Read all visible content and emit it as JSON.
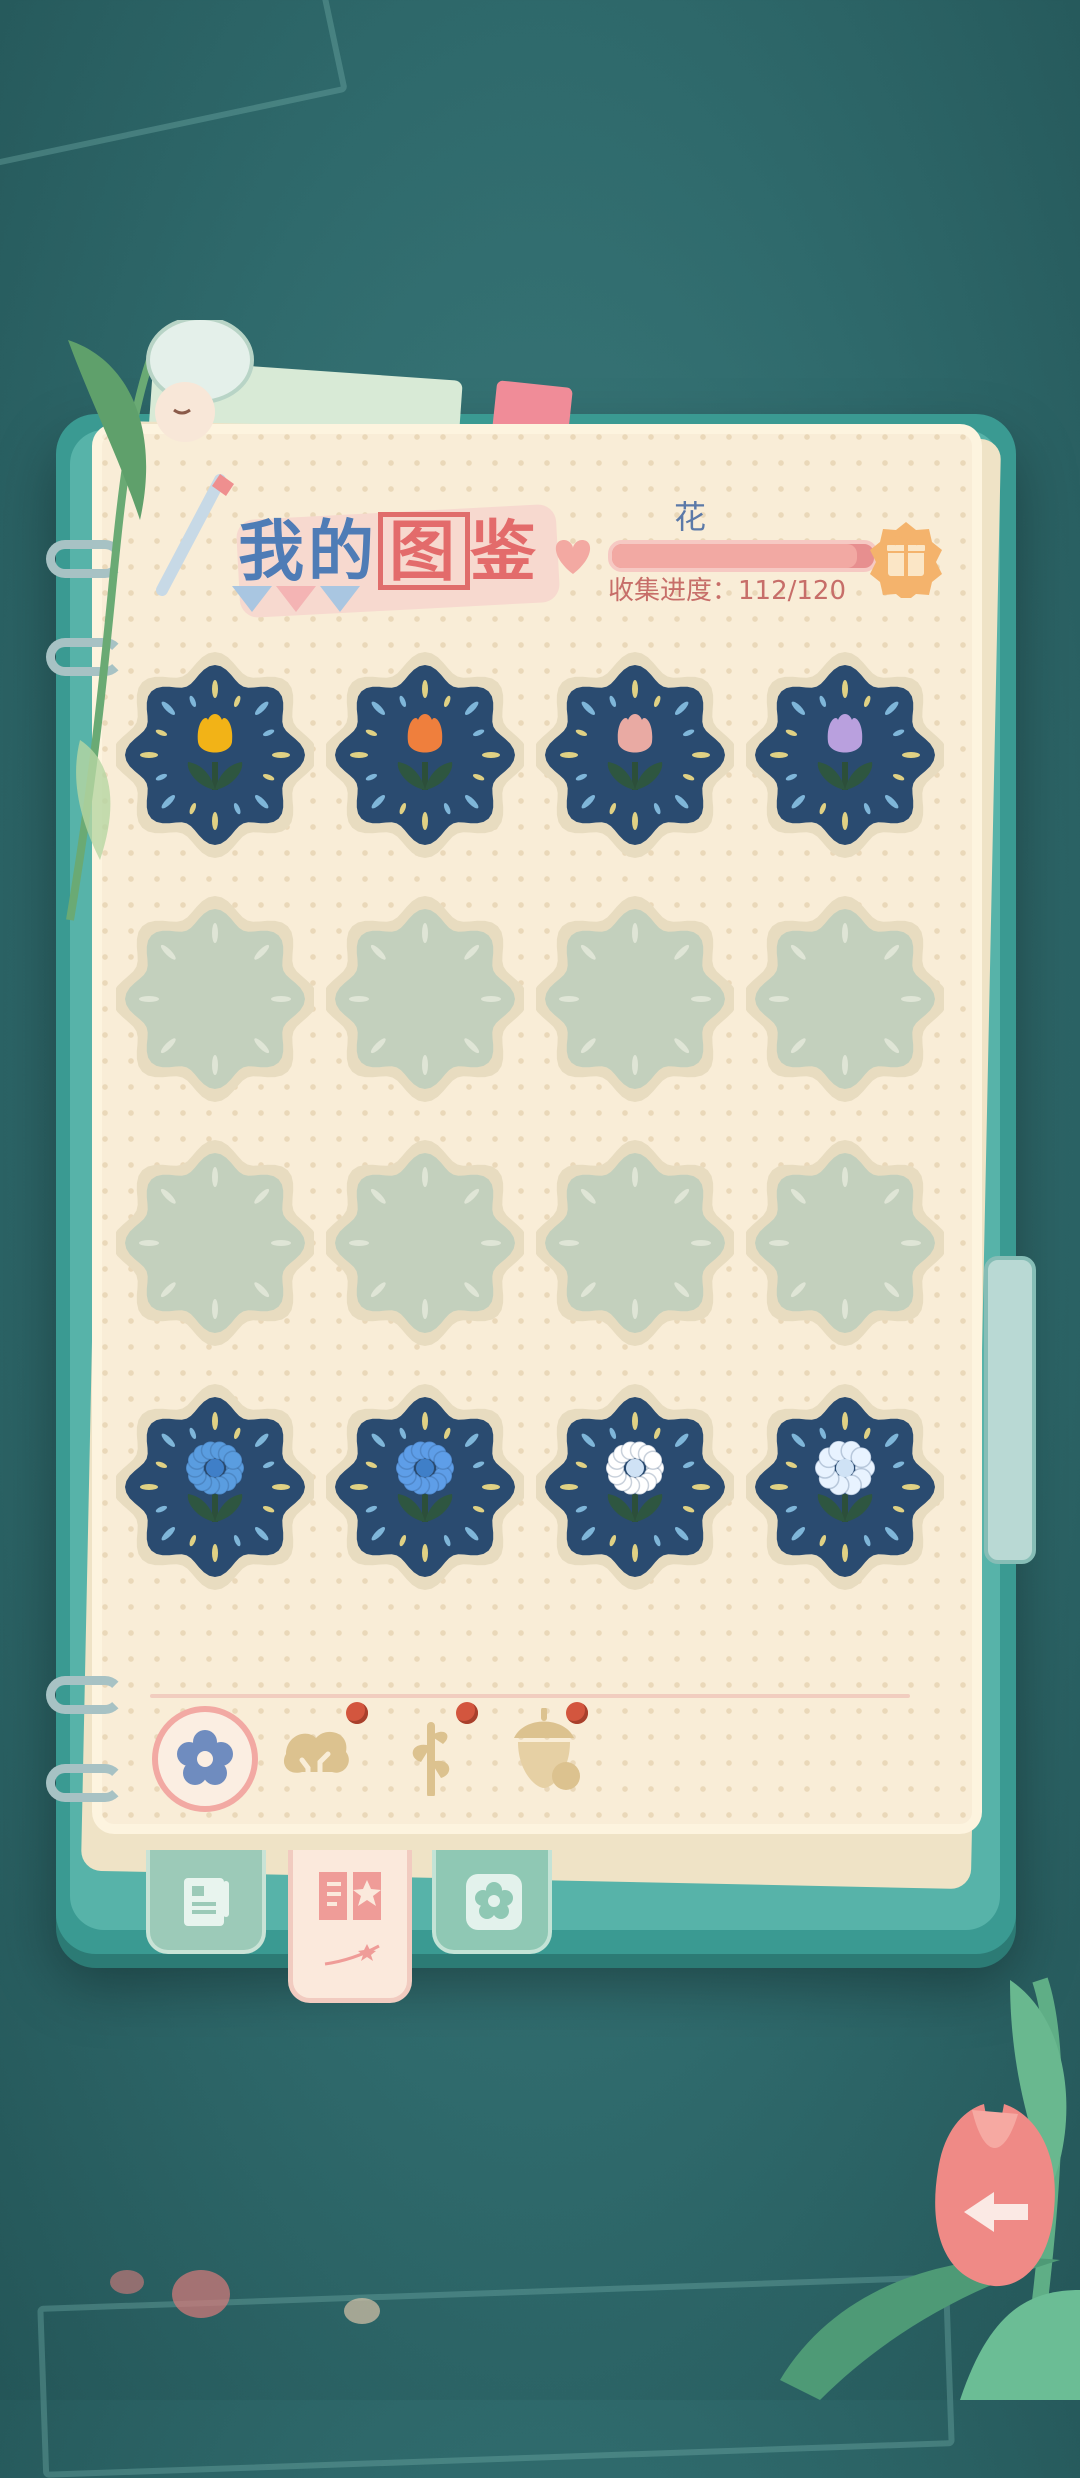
{
  "header": {
    "title_part1": "我的",
    "title_boxed": "图",
    "title_part3": "鉴",
    "category": "花",
    "progress_label": "收集进度：112/120",
    "progress": 0.9333
  },
  "slots": [
    {
      "status": "collected",
      "flower": "tulip",
      "color": "#f2b317"
    },
    {
      "status": "collected",
      "flower": "tulip",
      "color": "#ef7f3d"
    },
    {
      "status": "collected",
      "flower": "tulip",
      "color": "#e9aaa3"
    },
    {
      "status": "collected",
      "flower": "tulip",
      "color": "#b9a0de"
    },
    {
      "status": "locked"
    },
    {
      "status": "locked"
    },
    {
      "status": "locked"
    },
    {
      "status": "locked"
    },
    {
      "status": "locked"
    },
    {
      "status": "locked"
    },
    {
      "status": "locked"
    },
    {
      "status": "locked"
    },
    {
      "status": "collected",
      "flower": "daisy",
      "color": "#5a9de0"
    },
    {
      "status": "collected",
      "flower": "daisy",
      "color": "#5e9ee8"
    },
    {
      "status": "collected",
      "flower": "daisy",
      "color": "#ffffff"
    },
    {
      "status": "collected",
      "flower": "hydrangea",
      "color": "#e8f3ff"
    }
  ],
  "category_tabs": [
    {
      "icon": "flower-icon",
      "selected": true,
      "new": false
    },
    {
      "icon": "tree-icon",
      "selected": false,
      "new": true
    },
    {
      "icon": "herb-icon",
      "selected": false,
      "new": true
    },
    {
      "icon": "acorn-icon",
      "selected": false,
      "new": true
    }
  ],
  "book_tabs": [
    {
      "icon": "notebook-icon",
      "selected": false
    },
    {
      "icon": "catalog-book-icon",
      "selected": true
    },
    {
      "icon": "flower-badge-icon",
      "selected": false
    }
  ],
  "colors": {
    "slot_bg": "#2a4b70",
    "slot_ring": "#e8dcc0",
    "locked_fill": "#c3d0bd",
    "accent": "#e36b6b"
  }
}
